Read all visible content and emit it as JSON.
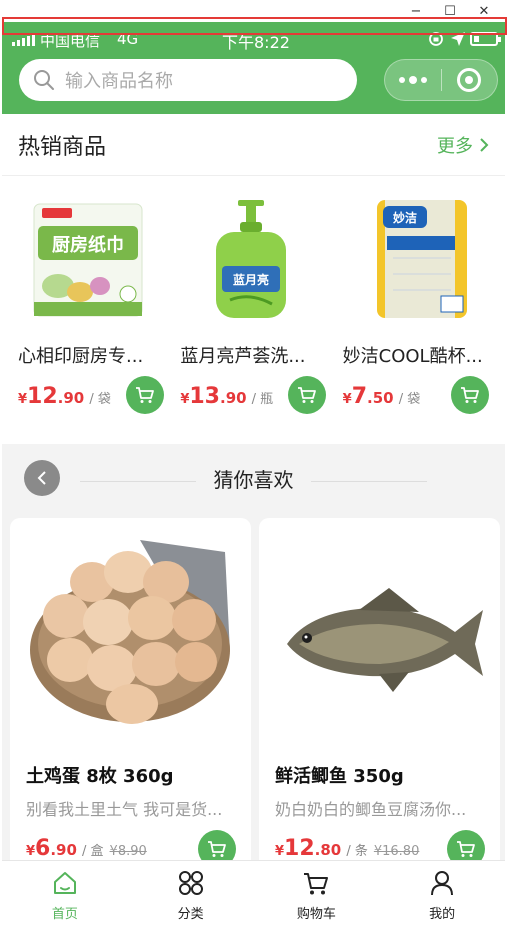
{
  "window": {
    "minimize_glyph": "−",
    "maximize_glyph": "☐",
    "close_glyph": "✕"
  },
  "status_bar": {
    "carrier": "中国电信",
    "network": "4G",
    "time": "下午8:22"
  },
  "search": {
    "placeholder": "输入商品名称"
  },
  "hot": {
    "title": "热销商品",
    "more_label": "更多",
    "items": [
      {
        "name": "心相印厨房专...",
        "currency": "¥",
        "price_int": "12",
        "price_dec": ".90",
        "unit": "/ 袋"
      },
      {
        "name": "蓝月亮芦荟洗...",
        "currency": "¥",
        "price_int": "13",
        "price_dec": ".90",
        "unit": "/ 瓶"
      },
      {
        "name": "妙洁COOL酷杯...",
        "currency": "¥",
        "price_int": "7",
        "price_dec": ".50",
        "unit": "/ 袋"
      }
    ]
  },
  "guess": {
    "title": "猜你喜欢",
    "items": [
      {
        "name": "土鸡蛋 8枚 360g",
        "desc": "别看我土里土气 我可是货...",
        "currency": "¥",
        "price_int": "6",
        "price_dec": ".90",
        "unit": "/ 盒",
        "old_price": "¥8.90"
      },
      {
        "name": "鲜活鲫鱼 350g",
        "desc": "奶白奶白的鲫鱼豆腐汤你...",
        "currency": "¥",
        "price_int": "12",
        "price_dec": ".80",
        "unit": "/ 条",
        "old_price": "¥16.80"
      }
    ]
  },
  "tabs": [
    {
      "label": "首页",
      "icon": "home-icon",
      "active": true
    },
    {
      "label": "分类",
      "icon": "category-icon"
    },
    {
      "label": "购物车",
      "icon": "cart-icon"
    },
    {
      "label": "我的",
      "icon": "user-icon"
    }
  ],
  "colors": {
    "brand_green": "#55b45b",
    "price_red": "#e5383a",
    "highlight_outline": "#e43a36"
  }
}
